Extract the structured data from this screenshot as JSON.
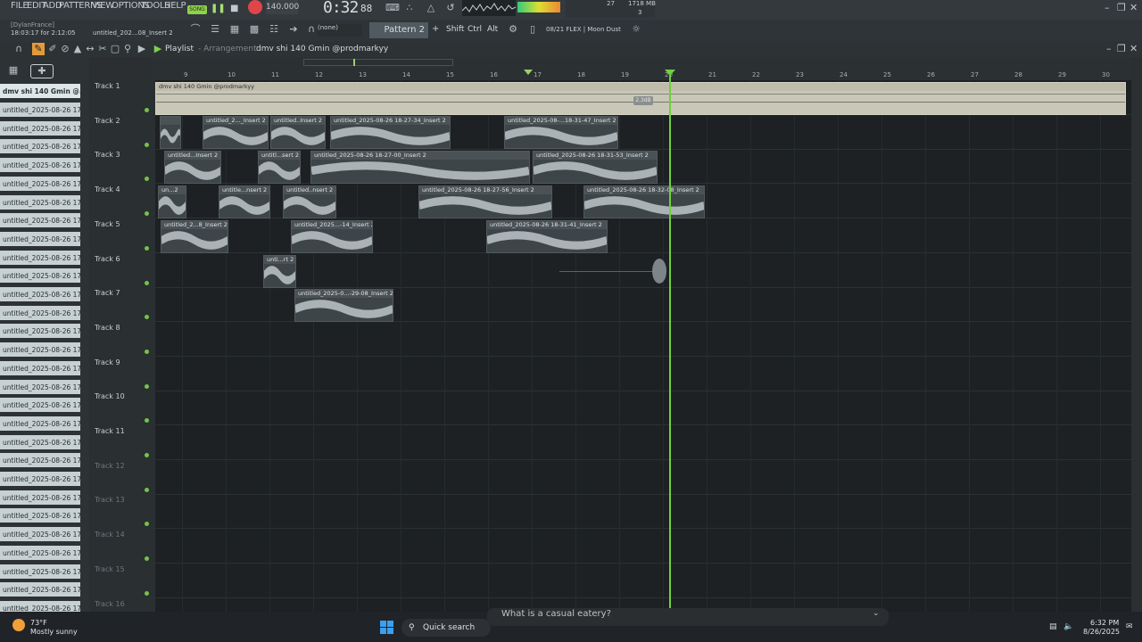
{
  "menu": [
    "FILE",
    "EDIT",
    "ADD",
    "PATTERNS",
    "VIEW",
    "OPTIONS",
    "TOOLS",
    "HELP"
  ],
  "transport": {
    "mode": "SONG",
    "tempo": "140.000",
    "time": "0:32",
    "time_frac": "88",
    "cpu": "27",
    "memory": "1718 MB",
    "voices": "3"
  },
  "hint": {
    "user": "[DylanFrance]",
    "time": "18:03:17 for 2:12:05",
    "name": "untitled_202...08_Insert 2"
  },
  "toolbar": {
    "snap": "(none)",
    "pattern": "Pattern 2",
    "plus": "+",
    "keys": [
      "Shift",
      "Ctrl",
      "Alt"
    ],
    "plugin": "08/21  FLEX | Moon Dust"
  },
  "playlist": {
    "title": "Playlist",
    "sub": "- Arrangement",
    "pattern_name": "dmv shi 140 Gmin @prodmarkyy",
    "db": "2.3dB"
  },
  "picker": {
    "top": "dmv shi 140 Gmin @...",
    "items": [
      "untitled_2025-08-26 17-...",
      "untitled_2025-08-26 17-...",
      "untitled_2025-08-26 17-...",
      "untitled_2025-08-26 17-...",
      "untitled_2025-08-26 17-...",
      "untitled_2025-08-26 17-...",
      "untitled_2025-08-26 17-...",
      "untitled_2025-08-26 17-...",
      "untitled_2025-08-26 17-...",
      "untitled_2025-08-26 17-...",
      "untitled_2025-08-26 17-...",
      "untitled_2025-08-26 17-...",
      "untitled_2025-08-26 17-...",
      "untitled_2025-08-26 17-...",
      "untitled_2025-08-26 17-...",
      "untitled_2025-08-26 17-...",
      "untitled_2025-08-26 17-...",
      "untitled_2025-08-26 17-...",
      "untitled_2025-08-26 17-...",
      "untitled_2025-08-26 17-...",
      "untitled_2025-08-26 17-...",
      "untitled_2025-08-26 17-...",
      "untitled_2025-08-26 17-...",
      "untitled_2025-08-26 17-...",
      "untitled_2025-08-26 17-...",
      "untitled_2025-08-26 17-...",
      "untitled_2025-08-26 17-...",
      "untitled_2025-08-26 17-...",
      "untitled_2025-08-26 17-..."
    ]
  },
  "tracks": [
    "Track 1",
    "Track 2",
    "Track 3",
    "Track 4",
    "Track 5",
    "Track 6",
    "Track 7",
    "Track 8",
    "Track 9",
    "Track 10",
    "Track 11",
    "Track 12",
    "Track 13",
    "Track 14",
    "Track 15",
    "Track 16"
  ],
  "bars": [
    "9",
    "10",
    "11",
    "12",
    "13",
    "14",
    "15",
    "16",
    "17",
    "18",
    "19",
    "20",
    "21",
    "22",
    "23",
    "24",
    "25",
    "26",
    "27",
    "28",
    "29",
    "30"
  ],
  "clips": {
    "t1": "dmv shi 140 Gmin @prodmarkyy",
    "t2a": "",
    "t2b": "untitled_2..._Insert 2",
    "t2c": "untitled..Insert 2",
    "t2d": "untitled_2025-08-26 18-27-34_Insert 2",
    "t2e": "untitled_2025-08-...18-31-47_Insert 2",
    "t3a": "untitled...Insert 2",
    "t3b": "untitl...sert 2",
    "t3c": "untitled_2025-08-26 18-27-00_Insert 2",
    "t3d": "untitled_2025-08-26 18-31-53_Insert 2",
    "t4a": "un...2",
    "t4b": "untitle...nsert 2",
    "t4c": "untitled..nsert 2",
    "t4d": "untitled_2025-08-26 18-27-56_Insert 2",
    "t4e": "untitled_2025-08-26 18-32-08_Insert 2",
    "t5a": "untitled_2...8_Insert 2",
    "t5b": "untitled_2025...-14_Insert 2",
    "t5c": "untitled_2025-08-26 18-31-41_Insert 2",
    "t6a": "unti...rt 2",
    "t7a": "untitled_2025-0...-29-08_Insert 2"
  },
  "taskbar": {
    "temp": "73°F",
    "weather": "Mostly sunny",
    "search": "Quick search",
    "suggestion": "What is a casual eatery?",
    "time": "6:32 PM",
    "date": "8/26/2025"
  }
}
